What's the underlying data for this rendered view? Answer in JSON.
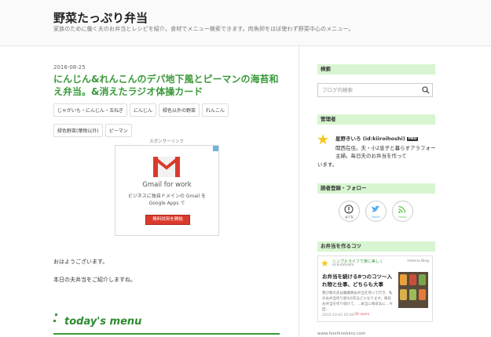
{
  "site": {
    "title": "野菜たっぷり弁当",
    "description": "家族のために働く夫のお弁当とレシピを紹介。食材でメニュー検索できます。肉魚卵をほぼ使わず野菜中心のメニュー。"
  },
  "entry": {
    "date": "2016-08-25",
    "title": "にんじん&れんこんのデパ地下風とピーマンの海苔和え弁当。&消えたラジオ体操カード",
    "categories": [
      "じゃがいも・にんじん・玉ねぎ",
      "にんじん",
      "緑色以外の野菜",
      "れんこん",
      "緑色野菜(葉物以外)",
      "ピーマン"
    ],
    "ad": {
      "label": "スポンサーリンク",
      "headline": "Gmail for work",
      "sub": "ビジネスに独自ドメインの Gmail を Google Apps で",
      "button": "無料試用を開始"
    },
    "paragraphs": [
      "おはようございます。",
      "本日の夫弁当をご紹介しますね。"
    ],
    "menu_heading": "today's menu"
  },
  "sidebar": {
    "search": {
      "title": "検索",
      "placeholder": "ブログ内検索"
    },
    "admin": {
      "title": "管理者",
      "name": "星野きいろ (id:kiiroihoshi)",
      "badge": "PRO",
      "desc1": "関西在住。夫・小2息子と暮らすアラフォー主婦。毎日夫のお弁当を作って",
      "desc2": "います。"
    },
    "follow": {
      "title": "読者登録・フォロー",
      "buttons": [
        "はてな",
        "Twitter",
        "Feedly"
      ]
    },
    "tips": {
      "title": "お弁当を作るコツ",
      "site": "シンプルライフで楽に美しく",
      "user": "id:kiroihoshi",
      "source": "Hatena Blog",
      "headline": "お弁当を続ける8つのコツ〜入れ物と仕事、どちらも大事",
      "body": "我が家の夫は職業柄お弁当を持って行き、私のお弁当作り歴も6年ほどになります。毎日お弁当を作り続けて、…本当に毎日気に…今回…",
      "date": "2015-10-03 05:00",
      "users": "30 users"
    },
    "footer": "www.hoshinokiiro.com"
  },
  "colors": {
    "accent_green": "#3a9a3a",
    "sidebar_heading_bg": "#d7f5d0",
    "ad_button": "#d93a2b"
  }
}
